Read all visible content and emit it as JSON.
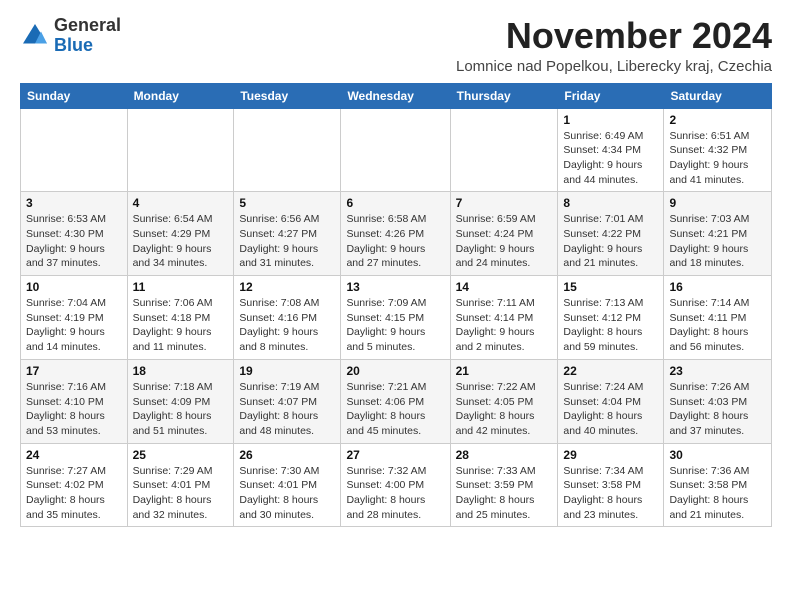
{
  "logo": {
    "general": "General",
    "blue": "Blue"
  },
  "title": "November 2024",
  "location": "Lomnice nad Popelkou, Liberecky kraj, Czechia",
  "days_of_week": [
    "Sunday",
    "Monday",
    "Tuesday",
    "Wednesday",
    "Thursday",
    "Friday",
    "Saturday"
  ],
  "weeks": [
    [
      {
        "day": "",
        "detail": ""
      },
      {
        "day": "",
        "detail": ""
      },
      {
        "day": "",
        "detail": ""
      },
      {
        "day": "",
        "detail": ""
      },
      {
        "day": "",
        "detail": ""
      },
      {
        "day": "1",
        "detail": "Sunrise: 6:49 AM\nSunset: 4:34 PM\nDaylight: 9 hours and 44 minutes."
      },
      {
        "day": "2",
        "detail": "Sunrise: 6:51 AM\nSunset: 4:32 PM\nDaylight: 9 hours and 41 minutes."
      }
    ],
    [
      {
        "day": "3",
        "detail": "Sunrise: 6:53 AM\nSunset: 4:30 PM\nDaylight: 9 hours and 37 minutes."
      },
      {
        "day": "4",
        "detail": "Sunrise: 6:54 AM\nSunset: 4:29 PM\nDaylight: 9 hours and 34 minutes."
      },
      {
        "day": "5",
        "detail": "Sunrise: 6:56 AM\nSunset: 4:27 PM\nDaylight: 9 hours and 31 minutes."
      },
      {
        "day": "6",
        "detail": "Sunrise: 6:58 AM\nSunset: 4:26 PM\nDaylight: 9 hours and 27 minutes."
      },
      {
        "day": "7",
        "detail": "Sunrise: 6:59 AM\nSunset: 4:24 PM\nDaylight: 9 hours and 24 minutes."
      },
      {
        "day": "8",
        "detail": "Sunrise: 7:01 AM\nSunset: 4:22 PM\nDaylight: 9 hours and 21 minutes."
      },
      {
        "day": "9",
        "detail": "Sunrise: 7:03 AM\nSunset: 4:21 PM\nDaylight: 9 hours and 18 minutes."
      }
    ],
    [
      {
        "day": "10",
        "detail": "Sunrise: 7:04 AM\nSunset: 4:19 PM\nDaylight: 9 hours and 14 minutes."
      },
      {
        "day": "11",
        "detail": "Sunrise: 7:06 AM\nSunset: 4:18 PM\nDaylight: 9 hours and 11 minutes."
      },
      {
        "day": "12",
        "detail": "Sunrise: 7:08 AM\nSunset: 4:16 PM\nDaylight: 9 hours and 8 minutes."
      },
      {
        "day": "13",
        "detail": "Sunrise: 7:09 AM\nSunset: 4:15 PM\nDaylight: 9 hours and 5 minutes."
      },
      {
        "day": "14",
        "detail": "Sunrise: 7:11 AM\nSunset: 4:14 PM\nDaylight: 9 hours and 2 minutes."
      },
      {
        "day": "15",
        "detail": "Sunrise: 7:13 AM\nSunset: 4:12 PM\nDaylight: 8 hours and 59 minutes."
      },
      {
        "day": "16",
        "detail": "Sunrise: 7:14 AM\nSunset: 4:11 PM\nDaylight: 8 hours and 56 minutes."
      }
    ],
    [
      {
        "day": "17",
        "detail": "Sunrise: 7:16 AM\nSunset: 4:10 PM\nDaylight: 8 hours and 53 minutes."
      },
      {
        "day": "18",
        "detail": "Sunrise: 7:18 AM\nSunset: 4:09 PM\nDaylight: 8 hours and 51 minutes."
      },
      {
        "day": "19",
        "detail": "Sunrise: 7:19 AM\nSunset: 4:07 PM\nDaylight: 8 hours and 48 minutes."
      },
      {
        "day": "20",
        "detail": "Sunrise: 7:21 AM\nSunset: 4:06 PM\nDaylight: 8 hours and 45 minutes."
      },
      {
        "day": "21",
        "detail": "Sunrise: 7:22 AM\nSunset: 4:05 PM\nDaylight: 8 hours and 42 minutes."
      },
      {
        "day": "22",
        "detail": "Sunrise: 7:24 AM\nSunset: 4:04 PM\nDaylight: 8 hours and 40 minutes."
      },
      {
        "day": "23",
        "detail": "Sunrise: 7:26 AM\nSunset: 4:03 PM\nDaylight: 8 hours and 37 minutes."
      }
    ],
    [
      {
        "day": "24",
        "detail": "Sunrise: 7:27 AM\nSunset: 4:02 PM\nDaylight: 8 hours and 35 minutes."
      },
      {
        "day": "25",
        "detail": "Sunrise: 7:29 AM\nSunset: 4:01 PM\nDaylight: 8 hours and 32 minutes."
      },
      {
        "day": "26",
        "detail": "Sunrise: 7:30 AM\nSunset: 4:01 PM\nDaylight: 8 hours and 30 minutes."
      },
      {
        "day": "27",
        "detail": "Sunrise: 7:32 AM\nSunset: 4:00 PM\nDaylight: 8 hours and 28 minutes."
      },
      {
        "day": "28",
        "detail": "Sunrise: 7:33 AM\nSunset: 3:59 PM\nDaylight: 8 hours and 25 minutes."
      },
      {
        "day": "29",
        "detail": "Sunrise: 7:34 AM\nSunset: 3:58 PM\nDaylight: 8 hours and 23 minutes."
      },
      {
        "day": "30",
        "detail": "Sunrise: 7:36 AM\nSunset: 3:58 PM\nDaylight: 8 hours and 21 minutes."
      }
    ]
  ]
}
